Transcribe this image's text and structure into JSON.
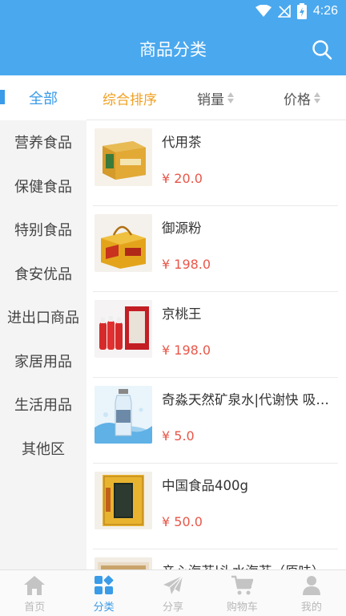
{
  "status": {
    "time": "4:26"
  },
  "header": {
    "title": "商品分类"
  },
  "sidebar": {
    "items": [
      {
        "label": "全部"
      },
      {
        "label": "营养食品"
      },
      {
        "label": "保健食品"
      },
      {
        "label": "特别食品"
      },
      {
        "label": "食安优品"
      },
      {
        "label": "进出口商品"
      },
      {
        "label": "家居用品"
      },
      {
        "label": "生活用品"
      },
      {
        "label": "其他区"
      }
    ]
  },
  "sort": {
    "comprehensive": "综合排序",
    "sales": "销量",
    "price": "价格"
  },
  "products": [
    {
      "name": "代用茶",
      "price": "¥ 20.0"
    },
    {
      "name": "御源粉",
      "price": "¥ 198.0"
    },
    {
      "name": "京桃王",
      "price": "¥ 198.0"
    },
    {
      "name": "奇淼天然矿泉水|代谢快 吸收好 补充人体所需矿物质",
      "price": "¥ 5.0"
    },
    {
      "name": "中国食品400g",
      "price": "¥ 50.0"
    },
    {
      "name": "亲心海苔|头水海苔（原味）",
      "price": ""
    }
  ],
  "tabs": [
    {
      "label": "首页",
      "icon": "home-icon"
    },
    {
      "label": "分类",
      "icon": "category-icon"
    },
    {
      "label": "分享",
      "icon": "share-icon"
    },
    {
      "label": "购物车",
      "icon": "cart-icon"
    },
    {
      "label": "我的",
      "icon": "user-icon"
    }
  ],
  "colors": {
    "primary": "#4aa8ee",
    "active": "#3a9be8",
    "sortActive": "#f0a020",
    "price": "#e8574a"
  }
}
